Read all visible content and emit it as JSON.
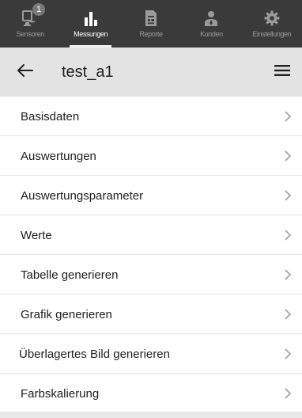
{
  "nav": {
    "items": [
      {
        "label": "Sensoren",
        "icon": "sensor-icon",
        "badge": "1",
        "active": false
      },
      {
        "label": "Messungen",
        "icon": "bar-chart-icon",
        "active": true
      },
      {
        "label": "Reporte",
        "icon": "report-icon",
        "active": false
      },
      {
        "label": "Kunden",
        "icon": "users-icon",
        "active": false
      },
      {
        "label": "Einstellungen",
        "icon": "gear-icon",
        "active": false
      }
    ]
  },
  "titlebar": {
    "back_icon": "arrow-left-icon",
    "title": "test_a1",
    "menu_icon": "hamburger-menu-icon"
  },
  "menu": {
    "items": [
      {
        "label": "Basisdaten"
      },
      {
        "label": "Auswertungen"
      },
      {
        "label": "Auswertungsparameter"
      },
      {
        "label": "Werte"
      },
      {
        "label": "Tabelle generieren"
      },
      {
        "label": "Grafik generieren"
      },
      {
        "label": "Überlagertes Bild generieren"
      },
      {
        "label": "Farbskalierung"
      }
    ],
    "chevron_icon": "chevron-right-icon"
  },
  "colors": {
    "nav_bg": "#3a3a3a",
    "titlebar_bg": "#e3e3e3",
    "inactive_label": "#9a9a9a",
    "active_label": "#ffffff"
  }
}
